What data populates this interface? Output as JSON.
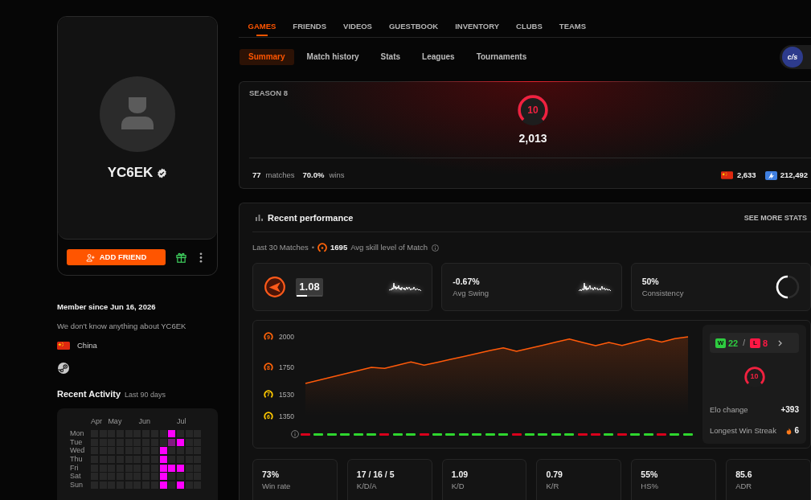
{
  "profile": {
    "name": "YC6EK",
    "verified": true,
    "add_friend": "ADD FRIEND",
    "member_since": "Member since Jun 16, 2026",
    "about": "We don't know anything about YC6EK",
    "country": "China"
  },
  "recent_activity": {
    "title": "Recent Activity",
    "subtitle": "Last 90 days",
    "months": [
      "Apr",
      "May",
      "Jun",
      "Jul"
    ],
    "days": [
      {
        "label": "Mon",
        "cells": [
          {
            "color": "#272727"
          },
          {
            "color": "#272727"
          },
          {
            "color": "#272727"
          },
          {
            "color": "#272727"
          },
          {
            "color": "#272727"
          },
          {
            "color": "#272727"
          },
          {
            "color": "#272727"
          },
          {
            "color": "#272727"
          },
          {
            "color": "#272727"
          },
          {
            "color": "#ff00ff"
          },
          {
            "color": "#272727"
          },
          {
            "color": "#272727"
          },
          {
            "color": "#272727"
          }
        ]
      },
      {
        "label": "Tue",
        "cells": [
          {
            "color": "#272727"
          },
          {
            "color": "#272727"
          },
          {
            "color": "#272727"
          },
          {
            "color": "#272727"
          },
          {
            "color": "#272727"
          },
          {
            "color": "#272727"
          },
          {
            "color": "#272727"
          },
          {
            "color": "#272727"
          },
          {
            "color": "#272727"
          },
          {
            "color": "#801a80"
          },
          {
            "color": "#ff00ff"
          },
          {
            "color": "#272727"
          },
          {
            "color": "#272727"
          }
        ]
      },
      {
        "label": "Wed",
        "cells": [
          {
            "color": "#272727"
          },
          {
            "color": "#272727"
          },
          {
            "color": "#272727"
          },
          {
            "color": "#272727"
          },
          {
            "color": "#272727"
          },
          {
            "color": "#272727"
          },
          {
            "color": "#272727"
          },
          {
            "color": "#272727"
          },
          {
            "color": "#ff00ff"
          },
          {
            "color": "#272727"
          },
          {
            "color": "#272727"
          },
          {
            "color": "#272727"
          },
          {
            "color": "#272727"
          }
        ]
      },
      {
        "label": "Thu",
        "cells": [
          {
            "color": "#272727"
          },
          {
            "color": "#272727"
          },
          {
            "color": "#272727"
          },
          {
            "color": "#272727"
          },
          {
            "color": "#272727"
          },
          {
            "color": "#272727"
          },
          {
            "color": "#272727"
          },
          {
            "color": "#272727"
          },
          {
            "color": "#ff00ff"
          },
          {
            "color": "#272727"
          },
          {
            "color": "#272727"
          },
          {
            "color": "#272727"
          },
          {
            "color": "#272727"
          }
        ]
      },
      {
        "label": "Fri",
        "cells": [
          {
            "color": "#272727"
          },
          {
            "color": "#272727"
          },
          {
            "color": "#272727"
          },
          {
            "color": "#272727"
          },
          {
            "color": "#272727"
          },
          {
            "color": "#272727"
          },
          {
            "color": "#272727"
          },
          {
            "color": "#272727"
          },
          {
            "color": "#ff00ff"
          },
          {
            "color": "#ff00ff"
          },
          {
            "color": "#ff00ff"
          },
          {
            "color": "#272727"
          },
          {
            "color": "#272727"
          }
        ]
      },
      {
        "label": "Sat",
        "cells": [
          {
            "color": "#272727"
          },
          {
            "color": "#272727"
          },
          {
            "color": "#272727"
          },
          {
            "color": "#272727"
          },
          {
            "color": "#272727"
          },
          {
            "color": "#272727"
          },
          {
            "color": "#272727"
          },
          {
            "color": "#272727"
          },
          {
            "color": "#ff00ff"
          },
          {
            "color": "#272727"
          },
          {
            "color": "#272727"
          },
          {
            "color": "#272727"
          },
          {
            "color": "#272727"
          }
        ]
      },
      {
        "label": "Sun",
        "cells": [
          {
            "color": "#272727"
          },
          {
            "color": "#272727"
          },
          {
            "color": "#272727"
          },
          {
            "color": "#272727"
          },
          {
            "color": "#272727"
          },
          {
            "color": "#272727"
          },
          {
            "color": "#272727"
          },
          {
            "color": "#272727"
          },
          {
            "color": "#ff00ff"
          },
          {
            "color": "#272727"
          },
          {
            "color": "#ff00ff"
          },
          {
            "color": "#272727"
          },
          {
            "color": "#272727"
          }
        ]
      }
    ]
  },
  "nav_tabs": [
    {
      "label": "GAMES",
      "selected": true
    },
    {
      "label": "FRIENDS",
      "selected": false
    },
    {
      "label": "VIDEOS",
      "selected": false
    },
    {
      "label": "GUESTBOOK",
      "selected": false
    },
    {
      "label": "INVENTORY",
      "selected": false
    },
    {
      "label": "CLUBS",
      "selected": false
    },
    {
      "label": "TEAMS",
      "selected": false
    }
  ],
  "sub_tabs": [
    {
      "label": "Summary",
      "selected": true
    },
    {
      "label": "Match history",
      "selected": false
    },
    {
      "label": "Stats",
      "selected": false
    },
    {
      "label": "Leagues",
      "selected": false
    },
    {
      "label": "Tournaments",
      "selected": false
    }
  ],
  "game_logo": "c/s",
  "season": {
    "title": "SEASON 8",
    "skill_level": "10",
    "elo": "2,013",
    "matches": "77",
    "matches_label": "matches",
    "win_rate": "70.0%",
    "win_rate_label": "wins",
    "country_rank": "2,633",
    "region_rank": "212,492"
  },
  "performance": {
    "title": "Recent performance",
    "more_link": "SEE MORE STATS",
    "matches_label": "Last 30 Matches",
    "separator": "•",
    "avg_skill": "1695",
    "avg_skill_label": "Avg skill level of Match",
    "cards": [
      {
        "kind": "rating",
        "value": "1.08",
        "level": 0.4
      },
      {
        "kind": "swing",
        "value": "-0.67%",
        "label": "Avg Swing"
      },
      {
        "kind": "ring",
        "value": "50%",
        "label": "Consistency",
        "level": 0.5
      }
    ],
    "chart": {
      "chart_data": {
        "type": "area",
        "categories": [
          null,
          null,
          null,
          null,
          null,
          null,
          null,
          null,
          null,
          null,
          null,
          null,
          null,
          null,
          null,
          null,
          null,
          null,
          null,
          null,
          null,
          null,
          null,
          null,
          null,
          null,
          null,
          null,
          null,
          null
        ],
        "series": [
          {
            "color": "#ff5a0a",
            "values": [
              1620,
              1646,
              1672,
              1698,
              1724,
              1750,
              1742,
              1769,
              1795,
              1768,
              1792,
              1816,
              1840,
              1864,
              1888,
              1910,
              1882,
              1907,
              1932,
              1957,
              1982,
              1955,
              1928,
              1954,
              1930,
              1957,
              1984,
              1957,
              1985,
              2000
            ]
          }
        ],
        "ylim": [
          1350,
          2000
        ],
        "yticks": [
          {
            "value": 2000,
            "label": "2000"
          },
          {
            "value": 1750,
            "label": "1750"
          },
          {
            "value": 1530,
            "label": "1530"
          },
          {
            "value": 1350,
            "label": "1350"
          }
        ]
      },
      "y_levels": [
        {
          "label": "9",
          "color": "#ff6309"
        },
        {
          "label": "8",
          "color": "#ff6309"
        },
        {
          "label": "7",
          "color": "#ffc800"
        },
        {
          "label": "6",
          "color": "#ffc800"
        }
      ],
      "results": [
        {
          "win": false
        },
        {
          "win": true
        },
        {
          "win": true
        },
        {
          "win": true
        },
        {
          "win": true
        },
        {
          "win": true
        },
        {
          "win": false
        },
        {
          "win": true
        },
        {
          "win": true
        },
        {
          "win": false
        },
        {
          "win": true
        },
        {
          "win": true
        },
        {
          "win": true
        },
        {
          "win": true
        },
        {
          "win": true
        },
        {
          "win": true
        },
        {
          "win": false
        },
        {
          "win": true
        },
        {
          "win": true
        },
        {
          "win": true
        },
        {
          "win": true
        },
        {
          "win": false
        },
        {
          "win": false
        },
        {
          "win": true
        },
        {
          "win": false
        },
        {
          "win": true
        },
        {
          "win": true
        },
        {
          "win": false
        },
        {
          "win": true
        },
        {
          "win": true
        }
      ]
    },
    "record": {
      "win_badge": "W",
      "wins": "22",
      "separator": "/",
      "loss_badge": "L",
      "losses": "8"
    },
    "skill_level": "10",
    "rows": [
      {
        "kind": "plain",
        "label": "Elo change",
        "value": "+393"
      },
      {
        "kind": "streak",
        "label": "Longest Win Streak",
        "value": "6"
      }
    ]
  },
  "stats": [
    {
      "value": "73%",
      "label": "Win rate"
    },
    {
      "value": "17 / 16 / 5",
      "label": "K/D/A"
    },
    {
      "value": "1.09",
      "label": "K/D"
    },
    {
      "value": "0.79",
      "label": "K/R"
    },
    {
      "value": "55%",
      "label": "HS%"
    },
    {
      "value": "85.6",
      "label": "ADR"
    }
  ]
}
